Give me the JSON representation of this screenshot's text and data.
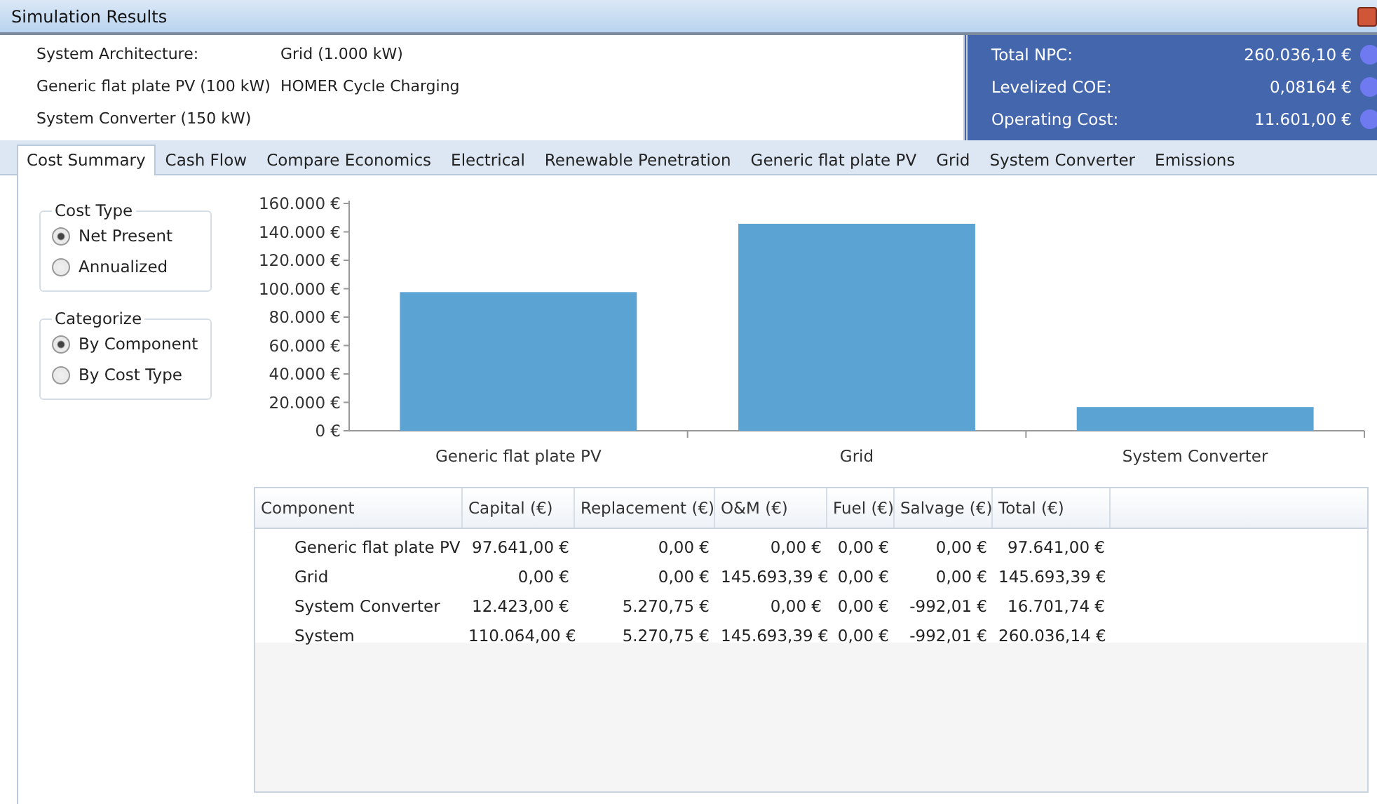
{
  "window": {
    "title": "Simulation Results"
  },
  "architecture": {
    "label": "System Architecture:",
    "lines": [
      "Grid (1.000 kW)",
      "Generic flat plate PV (100 kW)",
      "HOMER Cycle Charging",
      "System Converter (150 kW)"
    ]
  },
  "summary": [
    {
      "label": "Total NPC:",
      "value": "260.036,10 €"
    },
    {
      "label": "Levelized COE:",
      "value": "0,08164 €"
    },
    {
      "label": "Operating Cost:",
      "value": "11.601,00 €"
    }
  ],
  "tabs": [
    {
      "label": "Cost Summary",
      "selected": true
    },
    {
      "label": "Cash Flow",
      "selected": false
    },
    {
      "label": "Compare Economics",
      "selected": false
    },
    {
      "label": "Electrical",
      "selected": false
    },
    {
      "label": "Renewable Penetration",
      "selected": false
    },
    {
      "label": "Generic flat plate PV",
      "selected": false
    },
    {
      "label": "Grid",
      "selected": false
    },
    {
      "label": "System Converter",
      "selected": false
    },
    {
      "label": "Emissions",
      "selected": false
    }
  ],
  "groups": [
    {
      "title": "Cost Type",
      "options": [
        {
          "label": "Net Present",
          "selected": true
        },
        {
          "label": "Annualized",
          "selected": false
        }
      ]
    },
    {
      "title": "Categorize",
      "options": [
        {
          "label": "By Component",
          "selected": true
        },
        {
          "label": "By Cost Type",
          "selected": false
        }
      ]
    }
  ],
  "chart_data": {
    "type": "bar",
    "categories": [
      "Generic flat plate PV",
      "Grid",
      "System Converter"
    ],
    "values": [
      97600,
      145700,
      16700
    ],
    "ylim": [
      0,
      160000
    ],
    "yticks": [
      {
        "value": 0,
        "label": "0 €"
      },
      {
        "value": 20000,
        "label": "20.000 €"
      },
      {
        "value": 40000,
        "label": "40.000 €"
      },
      {
        "value": 60000,
        "label": "60.000 €"
      },
      {
        "value": 80000,
        "label": "80.000 €"
      },
      {
        "value": 100000,
        "label": "100.000 €"
      },
      {
        "value": 120000,
        "label": "120.000 €"
      },
      {
        "value": 140000,
        "label": "140.000 €"
      },
      {
        "value": 160000,
        "label": "160.000 €"
      }
    ]
  },
  "table": {
    "columns": [
      "Component",
      "Capital (€)",
      "Replacement (€)",
      "O&M (€)",
      "Fuel (€)",
      "Salvage (€)",
      "Total (€)"
    ],
    "rows": [
      [
        "Generic flat plate PV",
        "97.641,00 €",
        "0,00 €",
        "0,00 €",
        "0,00 €",
        "0,00 €",
        "97.641,00 €"
      ],
      [
        "Grid",
        "0,00 €",
        "0,00 €",
        "145.693,39 €",
        "0,00 €",
        "0,00 €",
        "145.693,39 €"
      ],
      [
        "System Converter",
        "12.423,00 €",
        "5.270,75 €",
        "0,00 €",
        "0,00 €",
        "-992,01 €",
        "16.701,74 €"
      ],
      [
        "System",
        "110.064,00 €",
        "5.270,75 €",
        "145.693,39 €",
        "0,00 €",
        "-992,01 €",
        "260.036,14 €"
      ]
    ]
  }
}
